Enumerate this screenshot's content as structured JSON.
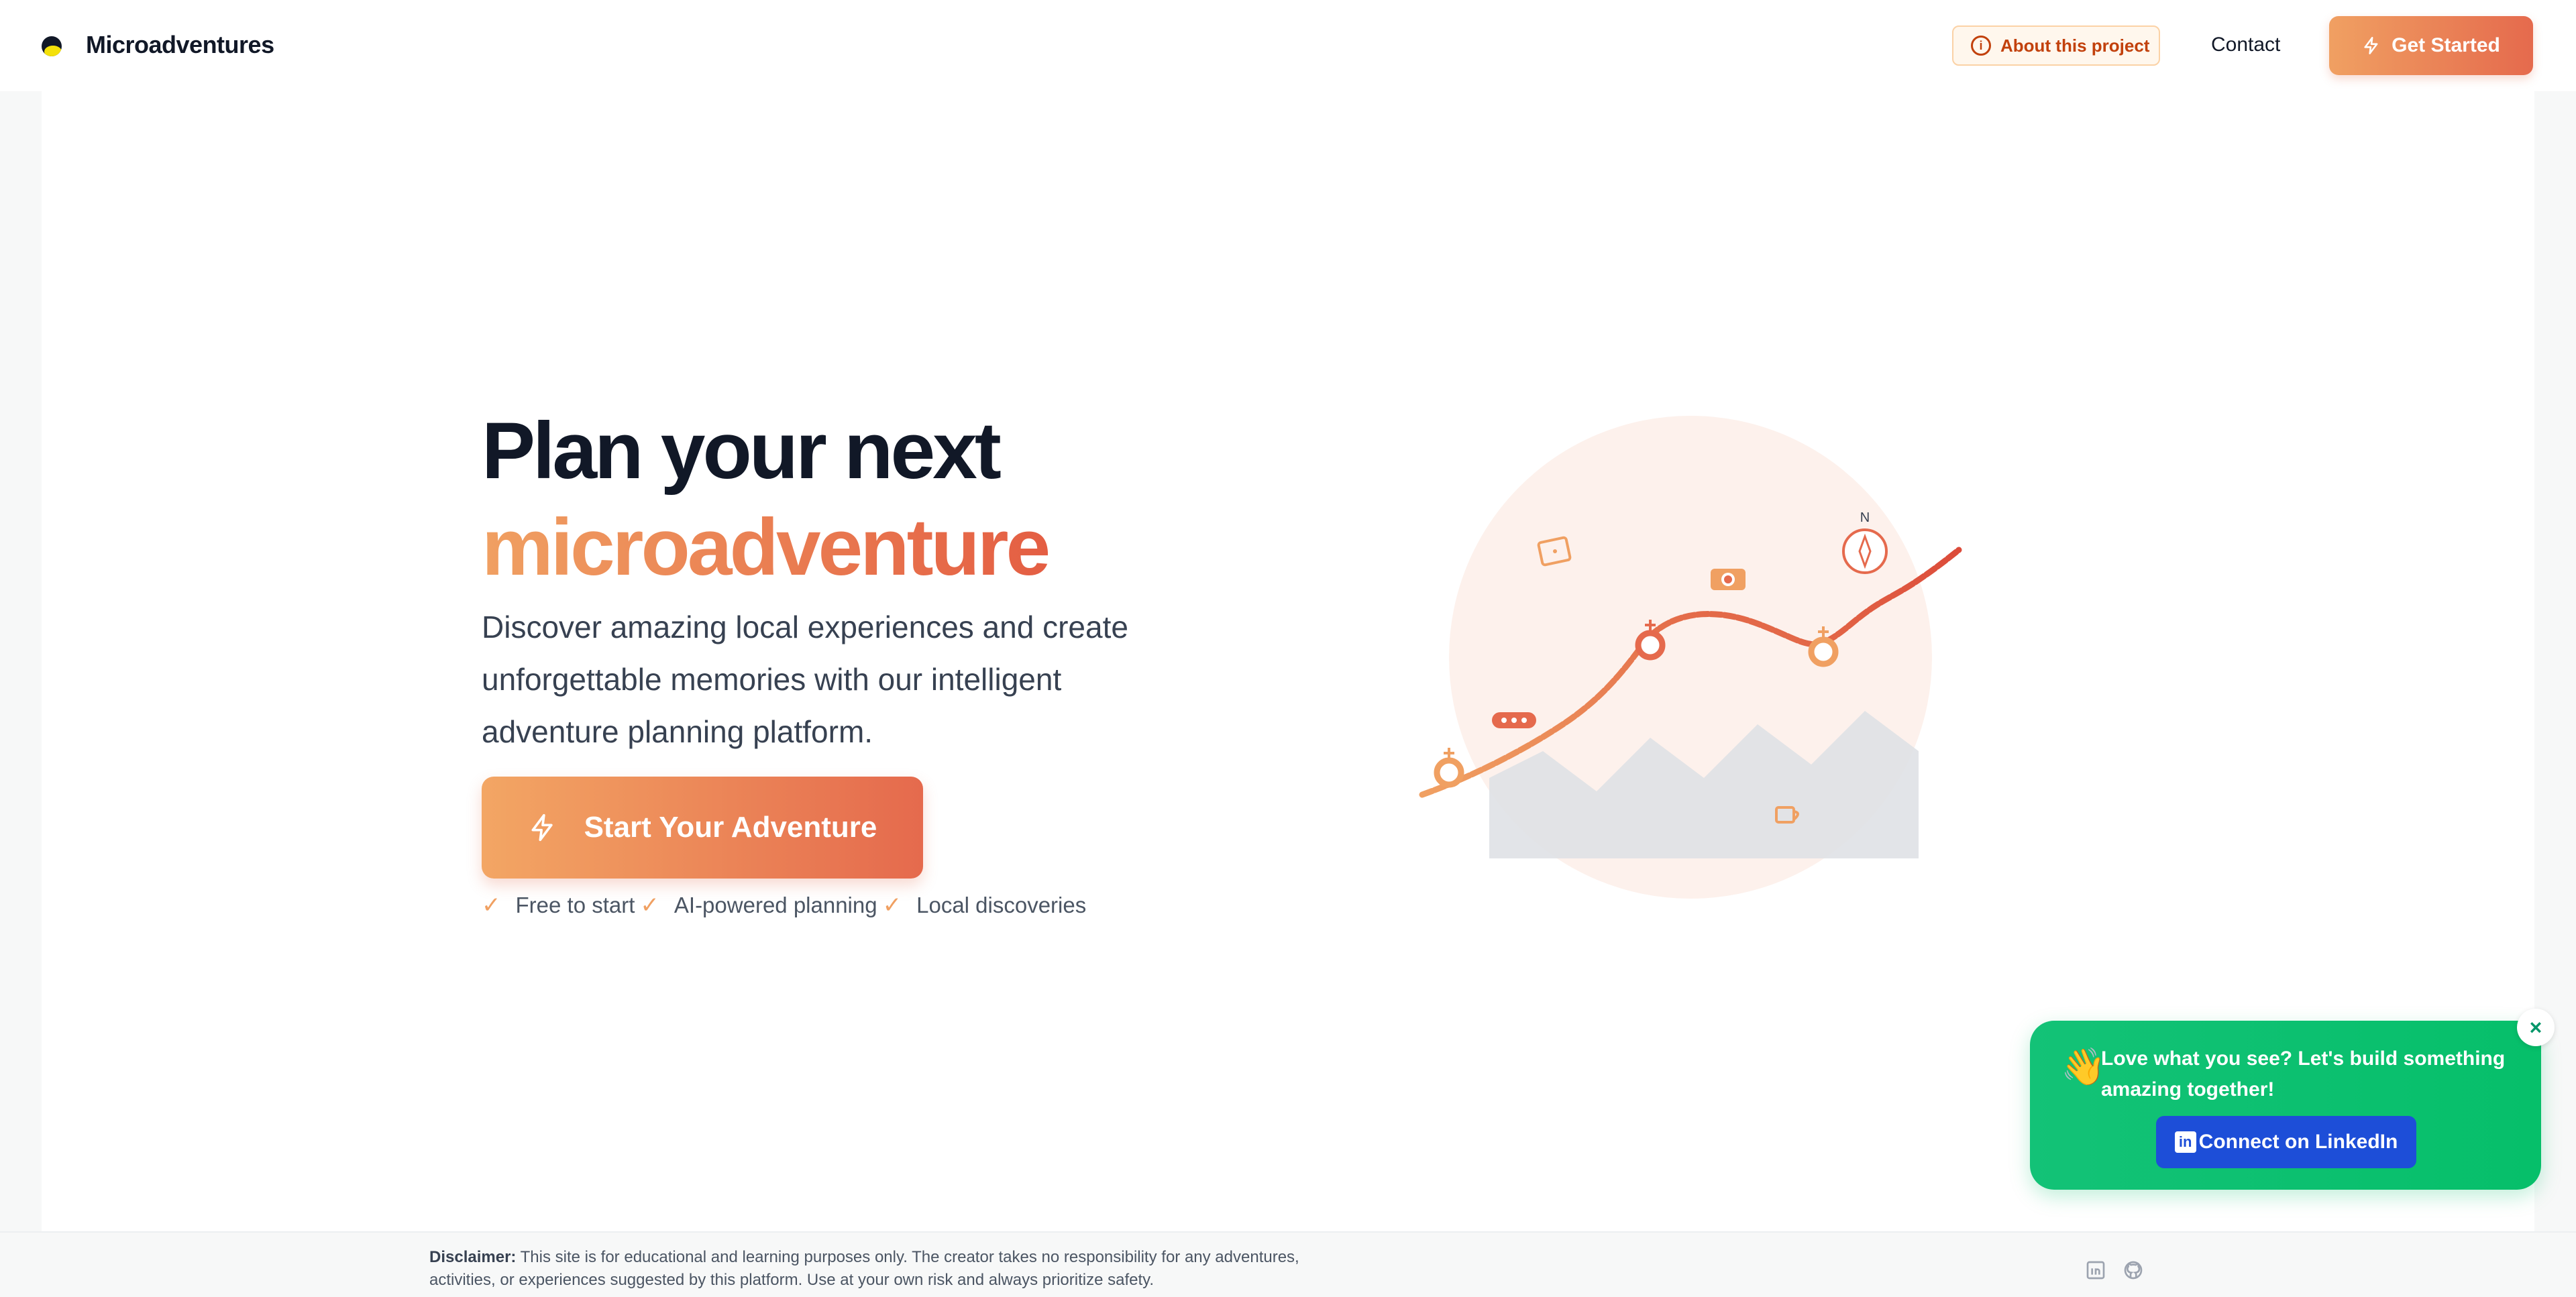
{
  "header": {
    "brand": "Microadventures",
    "about_label": "About this project",
    "contact_label": "Contact",
    "get_started_label": "Get Started"
  },
  "hero": {
    "title_line1": "Plan your next",
    "title_line2": "microadventure",
    "subtitle": "Discover amazing local experiences and create unforgettable memories with our intelligent adventure planning platform.",
    "cta_label": "Start Your Adventure",
    "features": [
      "Free to start",
      "AI-powered planning",
      "Local discoveries"
    ]
  },
  "illustration": {
    "compass_label": "N"
  },
  "footer": {
    "disclaimer_label": "Disclaimer:",
    "disclaimer_text": " This site is for educational and learning purposes only. The creator takes no responsibility for any adventures, activities, or experiences suggested by this platform. Use at your own risk and always prioritize safety.",
    "icons": [
      "linkedin-icon",
      "github-icon"
    ]
  },
  "popup": {
    "wave": "👋",
    "message": "Love what you see? Let's build something amazing together!",
    "button_label": "Connect on LinkedIn",
    "close": "×"
  },
  "colors": {
    "accent_start": "#f0a062",
    "accent_end": "#e56a4d",
    "popup_green": "#06bf6a",
    "linkedin_blue": "#1d4ed8"
  }
}
